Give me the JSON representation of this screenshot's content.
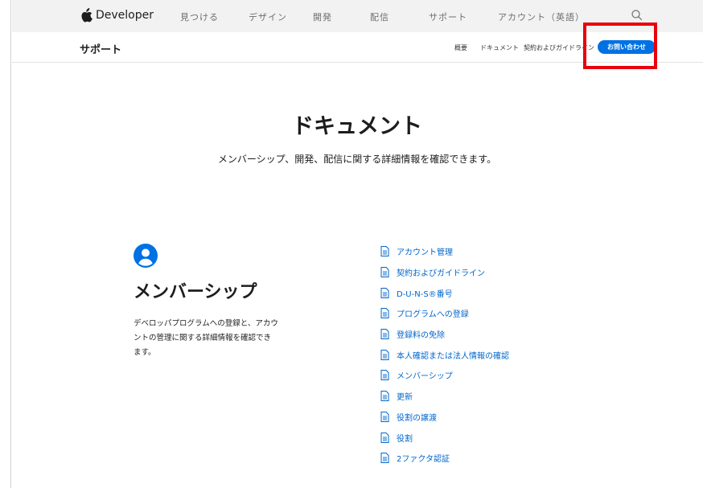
{
  "globalnav": {
    "brand": "Developer",
    "links": [
      "見つける",
      "デザイン",
      "開発",
      "配信",
      "サポート",
      "アカウント（英語）"
    ]
  },
  "localnav": {
    "title": "サポート",
    "links": [
      "概要",
      "ドキュメント",
      "契約およびガイドライン"
    ],
    "cta": "お問い合わせ"
  },
  "hero": {
    "title": "ドキュメント",
    "subtitle": "メンバーシップ、開発、配信に関する詳細情報を確認できます。"
  },
  "membership": {
    "title": "メンバーシップ",
    "description": "デベロッパプログラムへの登録と、アカウントの管理に関する詳細情報を確認できます。"
  },
  "documents": [
    "アカウント管理",
    "契約およびガイドライン",
    "D-U-N-S®番号",
    "プログラムへの登録",
    "登録料の免除",
    "本人確認または法人情報の確認",
    "メンバーシップ",
    "更新",
    "役割の譲渡",
    "役割",
    "2ファクタ認証"
  ],
  "colors": {
    "accent": "#0071e3",
    "link": "#0066cc",
    "highlight": "#e8000b",
    "nav_bg": "#f2f2f2"
  },
  "icons": {
    "brand": "apple-logo-icon",
    "search": "search-icon",
    "membership": "person-circle-icon",
    "document": "document-icon"
  }
}
